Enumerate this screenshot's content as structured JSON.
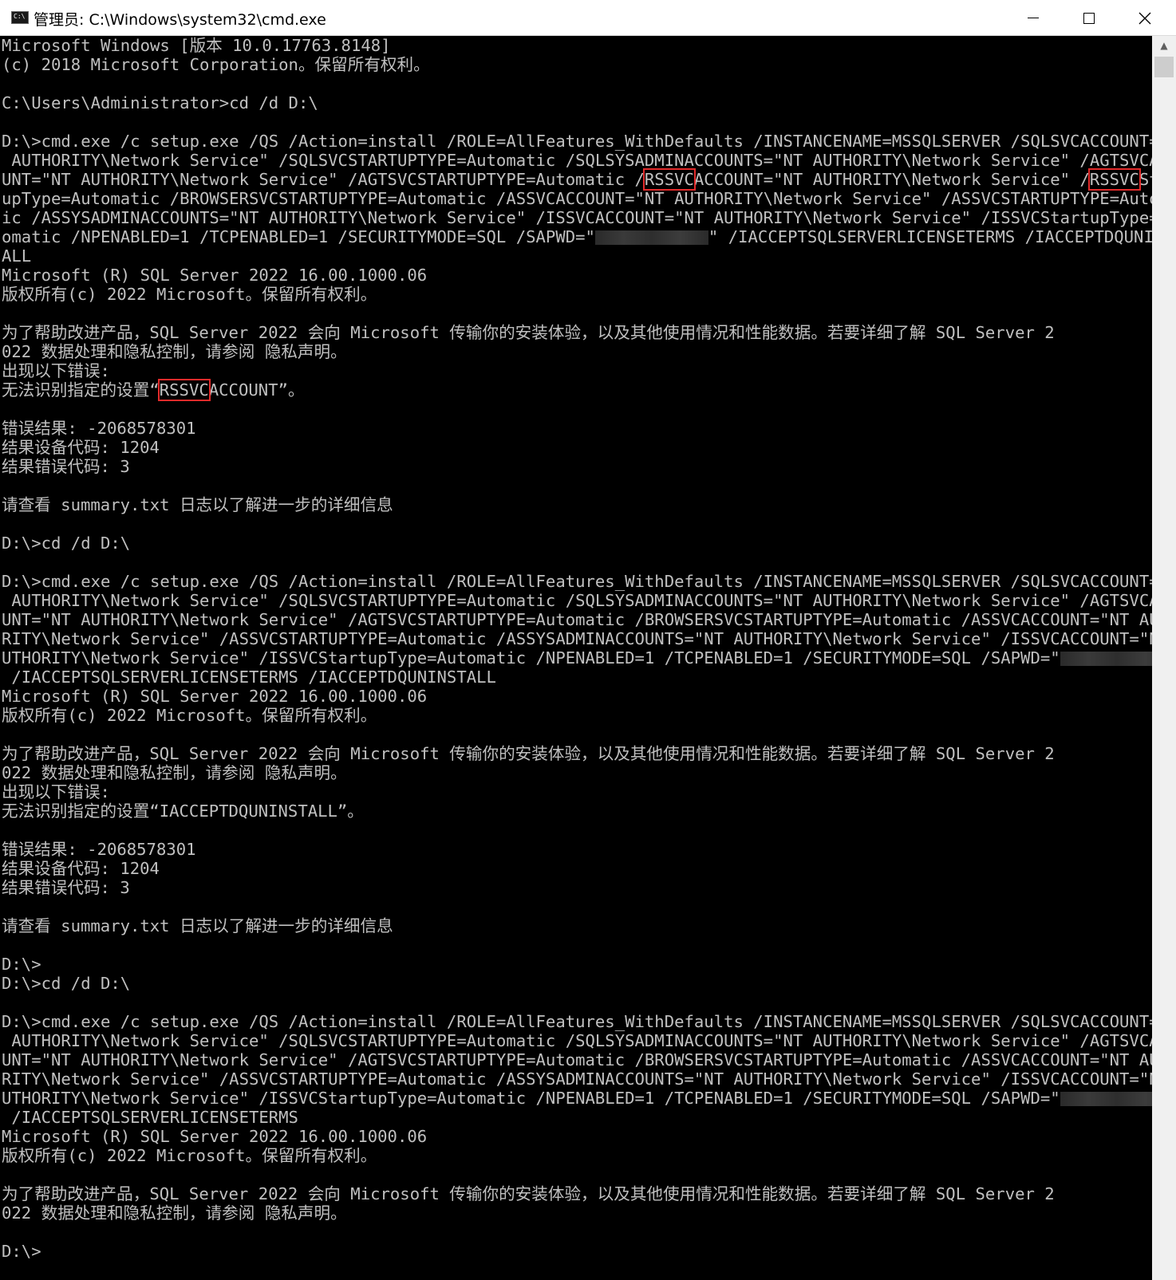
{
  "window": {
    "title": "管理员: C:\\Windows\\system32\\cmd.exe",
    "controls": {
      "minimize": "minimize",
      "maximize": "maximize",
      "close": "close"
    }
  },
  "console": {
    "lines": [
      "Microsoft Windows [版本 10.0.17763.8148]",
      "(c) 2018 Microsoft Corporation。保留所有权利。",
      "",
      "C:\\Users\\Administrator>cd /d D:\\",
      "",
      "D:\\>cmd.exe /c setup.exe /QS /Action=install /ROLE=AllFeatures_WithDefaults /INSTANCENAME=MSSQLSERVER /SQLSVCACCOUNT=\"NT",
      " AUTHORITY\\Network Service\" /SQLSVCSTARTUPTYPE=Automatic /SQLSYSADMINACCOUNTS=\"NT AUTHORITY\\Network Service\" /AGTSVCACCO",
      "UNT=\"NT AUTHORITY\\Network Service\" /AGTSVCSTARTUPTYPE=Automatic /RSSVCACCOUNT=\"NT AUTHORITY\\Network Service\" /RSSVCStart",
      "upType=Automatic /BROWSERSVCSTARTUPTYPE=Automatic /ASSVCACCOUNT=\"NT AUTHORITY\\Network Service\" /ASSVCSTARTUPTYPE=Automat",
      "ic /ASSYSADMINACCOUNTS=\"NT AUTHORITY\\Network Service\" /ISSVCACCOUNT=\"NT AUTHORITY\\Network Service\" /ISSVCStartupType=Aut",
      "omatic /NPENABLED=1 /TCPENABLED=1 /SECURITYMODE=SQL /SAPWD=\"[REDACTED]\" /IACCEPTSQLSERVERLICENSETERMS /IACCEPTDQUNINST",
      "ALL",
      "Microsoft (R) SQL Server 2022 16.00.1000.06",
      "版权所有(c) 2022 Microsoft。保留所有权利。",
      "",
      "为了帮助改进产品，SQL Server 2022 会向 Microsoft 传输你的安装体验，以及其他使用情况和性能数据。若要详细了解 SQL Server 2",
      "022 数据处理和隐私控制，请参阅 隐私声明。",
      "出现以下错误:",
      "无法识别指定的设置“RSSVCACCOUNT”。",
      "",
      "错误结果: -2068578301",
      "结果设备代码: 1204",
      "结果错误代码: 3",
      "",
      "请查看 summary.txt 日志以了解进一步的详细信息",
      "",
      "D:\\>cd /d D:\\",
      "",
      "D:\\>cmd.exe /c setup.exe /QS /Action=install /ROLE=AllFeatures_WithDefaults /INSTANCENAME=MSSQLSERVER /SQLSVCACCOUNT=\"NT",
      " AUTHORITY\\Network Service\" /SQLSVCSTARTUPTYPE=Automatic /SQLSYSADMINACCOUNTS=\"NT AUTHORITY\\Network Service\" /AGTSVCACCO",
      "UNT=\"NT AUTHORITY\\Network Service\" /AGTSVCSTARTUPTYPE=Automatic /BROWSERSVCSTARTUPTYPE=Automatic /ASSVCACCOUNT=\"NT AUTHO",
      "RITY\\Network Service\" /ASSVCSTARTUPTYPE=Automatic /ASSYSADMINACCOUNTS=\"NT AUTHORITY\\Network Service\" /ISSVCACCOUNT=\"NT A",
      "UTHORITY\\Network Service\" /ISSVCStartupType=Automatic /NPENABLED=1 /TCPENABLED=1 /SECURITYMODE=SQL /SAPWD=\"[REDACTED]\"",
      " /IACCEPTSQLSERVERLICENSETERMS /IACCEPTDQUNINSTALL",
      "Microsoft (R) SQL Server 2022 16.00.1000.06",
      "版权所有(c) 2022 Microsoft。保留所有权利。",
      "",
      "为了帮助改进产品，SQL Server 2022 会向 Microsoft 传输你的安装体验，以及其他使用情况和性能数据。若要详细了解 SQL Server 2",
      "022 数据处理和隐私控制，请参阅 隐私声明。",
      "出现以下错误:",
      "无法识别指定的设置“IACCEPTDQUNINSTALL”。",
      "",
      "错误结果: -2068578301",
      "结果设备代码: 1204",
      "结果错误代码: 3",
      "",
      "请查看 summary.txt 日志以了解进一步的详细信息",
      "",
      "D:\\>",
      "D:\\>cd /d D:\\",
      "",
      "D:\\>cmd.exe /c setup.exe /QS /Action=install /ROLE=AllFeatures_WithDefaults /INSTANCENAME=MSSQLSERVER /SQLSVCACCOUNT=\"NT",
      " AUTHORITY\\Network Service\" /SQLSVCSTARTUPTYPE=Automatic /SQLSYSADMINACCOUNTS=\"NT AUTHORITY\\Network Service\" /AGTSVCACCO",
      "UNT=\"NT AUTHORITY\\Network Service\" /AGTSVCSTARTUPTYPE=Automatic /BROWSERSVCSTARTUPTYPE=Automatic /ASSVCACCOUNT=\"NT AUTHO",
      "RITY\\Network Service\" /ASSVCSTARTUPTYPE=Automatic /ASSYSADMINACCOUNTS=\"NT AUTHORITY\\Network Service\" /ISSVCACCOUNT=\"NT A",
      "UTHORITY\\Network Service\" /ISSVCStartupType=Automatic /NPENABLED=1 /TCPENABLED=1 /SECURITYMODE=SQL /SAPWD=\"[REDACTED]\"",
      " /IACCEPTSQLSERVERLICENSETERMS",
      "Microsoft (R) SQL Server 2022 16.00.1000.06",
      "版权所有(c) 2022 Microsoft。保留所有权利。",
      "",
      "为了帮助改进产品，SQL Server 2022 会向 Microsoft 传输你的安装体验，以及其他使用情况和性能数据。若要详细了解 SQL Server 2",
      "022 数据处理和隐私控制，请参阅 隐私声明。",
      "",
      "D:\\>"
    ],
    "highlight_token": "RSSVC",
    "highlight_lines": [
      7,
      18
    ],
    "highlight_color": "#e22b2b",
    "redaction_token": "[REDACTED]",
    "cursor_line": 68,
    "text_color": "#c0c0c0",
    "background_color": "#000000"
  }
}
